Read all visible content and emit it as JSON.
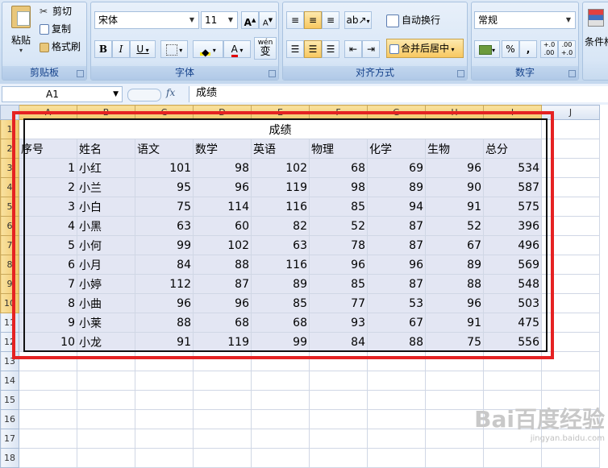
{
  "ribbon": {
    "clipboard": {
      "label": "剪贴板",
      "paste": "粘贴",
      "cut": "剪切",
      "copy": "复制",
      "format_painter": "格式刷"
    },
    "font": {
      "label": "字体",
      "name": "宋体",
      "size": "11",
      "bold": "B",
      "italic": "I",
      "underline": "U",
      "grow": "A",
      "shrink": "A",
      "font_color": "A",
      "phonetic": "wén",
      "phonetic_char": "变"
    },
    "alignment": {
      "label": "对齐方式",
      "wrap": "自动换行",
      "merge": "合并后居中"
    },
    "number": {
      "label": "数字",
      "format": "常规",
      "percent": "%",
      "comma": ",",
      "inc_decimal": "+.0 .00",
      "dec_decimal": ".00 +.0"
    },
    "styles": {
      "label": "条件格"
    }
  },
  "formula_bar": {
    "name_box": "A1",
    "fx": "fx",
    "content": "成绩"
  },
  "columns": [
    "A",
    "B",
    "C",
    "D",
    "E",
    "F",
    "G",
    "H",
    "I",
    "J"
  ],
  "rows": [
    "1",
    "2",
    "3",
    "4",
    "5",
    "6",
    "7",
    "8",
    "9",
    "10",
    "11",
    "12",
    "13",
    "14",
    "15",
    "16",
    "17",
    "18"
  ],
  "sheet": {
    "title": "成绩",
    "headers": [
      "序号",
      "姓名",
      "语文",
      "数学",
      "英语",
      "物理",
      "化学",
      "生物",
      "总分"
    ],
    "records": [
      [
        "1",
        "小红",
        "101",
        "98",
        "102",
        "68",
        "69",
        "96",
        "534"
      ],
      [
        "2",
        "小兰",
        "95",
        "96",
        "119",
        "98",
        "89",
        "90",
        "587"
      ],
      [
        "3",
        "小白",
        "75",
        "114",
        "116",
        "85",
        "94",
        "91",
        "575"
      ],
      [
        "4",
        "小黑",
        "63",
        "60",
        "82",
        "52",
        "87",
        "52",
        "396"
      ],
      [
        "5",
        "小何",
        "99",
        "102",
        "63",
        "78",
        "87",
        "67",
        "496"
      ],
      [
        "6",
        "小月",
        "84",
        "88",
        "116",
        "96",
        "96",
        "89",
        "569"
      ],
      [
        "7",
        "小婷",
        "112",
        "87",
        "89",
        "85",
        "87",
        "88",
        "548"
      ],
      [
        "8",
        "小曲",
        "96",
        "96",
        "85",
        "77",
        "53",
        "96",
        "503"
      ],
      [
        "9",
        "小莱",
        "88",
        "68",
        "68",
        "93",
        "67",
        "91",
        "475"
      ],
      [
        "10",
        "小龙",
        "91",
        "119",
        "99",
        "84",
        "88",
        "75",
        "556"
      ]
    ]
  },
  "watermark": {
    "brand": "Bai百度经验",
    "url": "jingyan.baidu.com"
  },
  "colors": {
    "highlight": "#e52222",
    "selection": "#e3e6f3",
    "header_active": "#f2c76a"
  }
}
